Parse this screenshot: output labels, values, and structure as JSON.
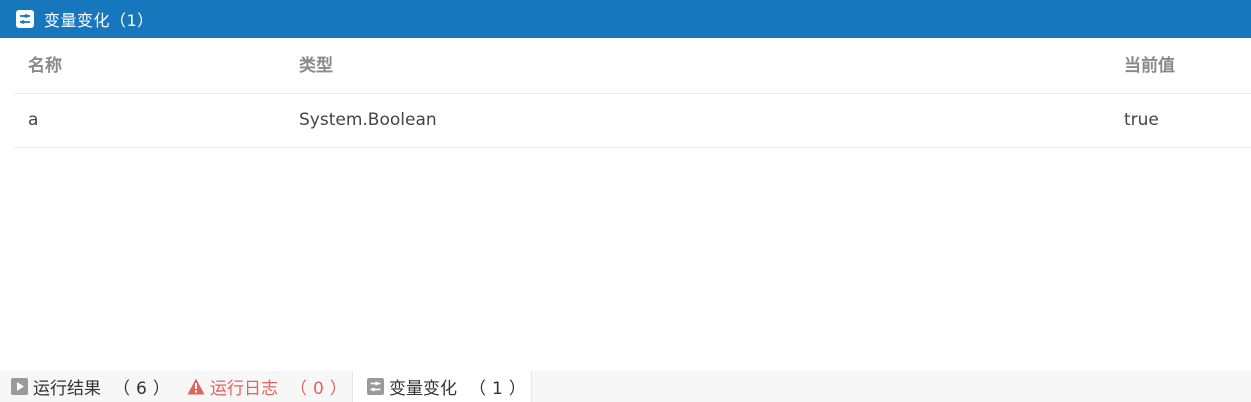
{
  "header": {
    "title": "变量变化（1）",
    "icon": "variables-icon",
    "background": "#1677bd"
  },
  "table": {
    "columns": [
      "名称",
      "类型",
      "当前值"
    ],
    "rows": [
      {
        "name": "a",
        "type": "System.Boolean",
        "value": "true"
      }
    ]
  },
  "tabs": [
    {
      "label": "运行结果",
      "count": "（6）",
      "icon": "play-icon"
    },
    {
      "label": "运行日志",
      "count": "（0）",
      "icon": "warning-icon",
      "color": "#e0635f"
    },
    {
      "label": "变量变化",
      "count": "（1）",
      "icon": "variables-icon",
      "active": true
    }
  ]
}
